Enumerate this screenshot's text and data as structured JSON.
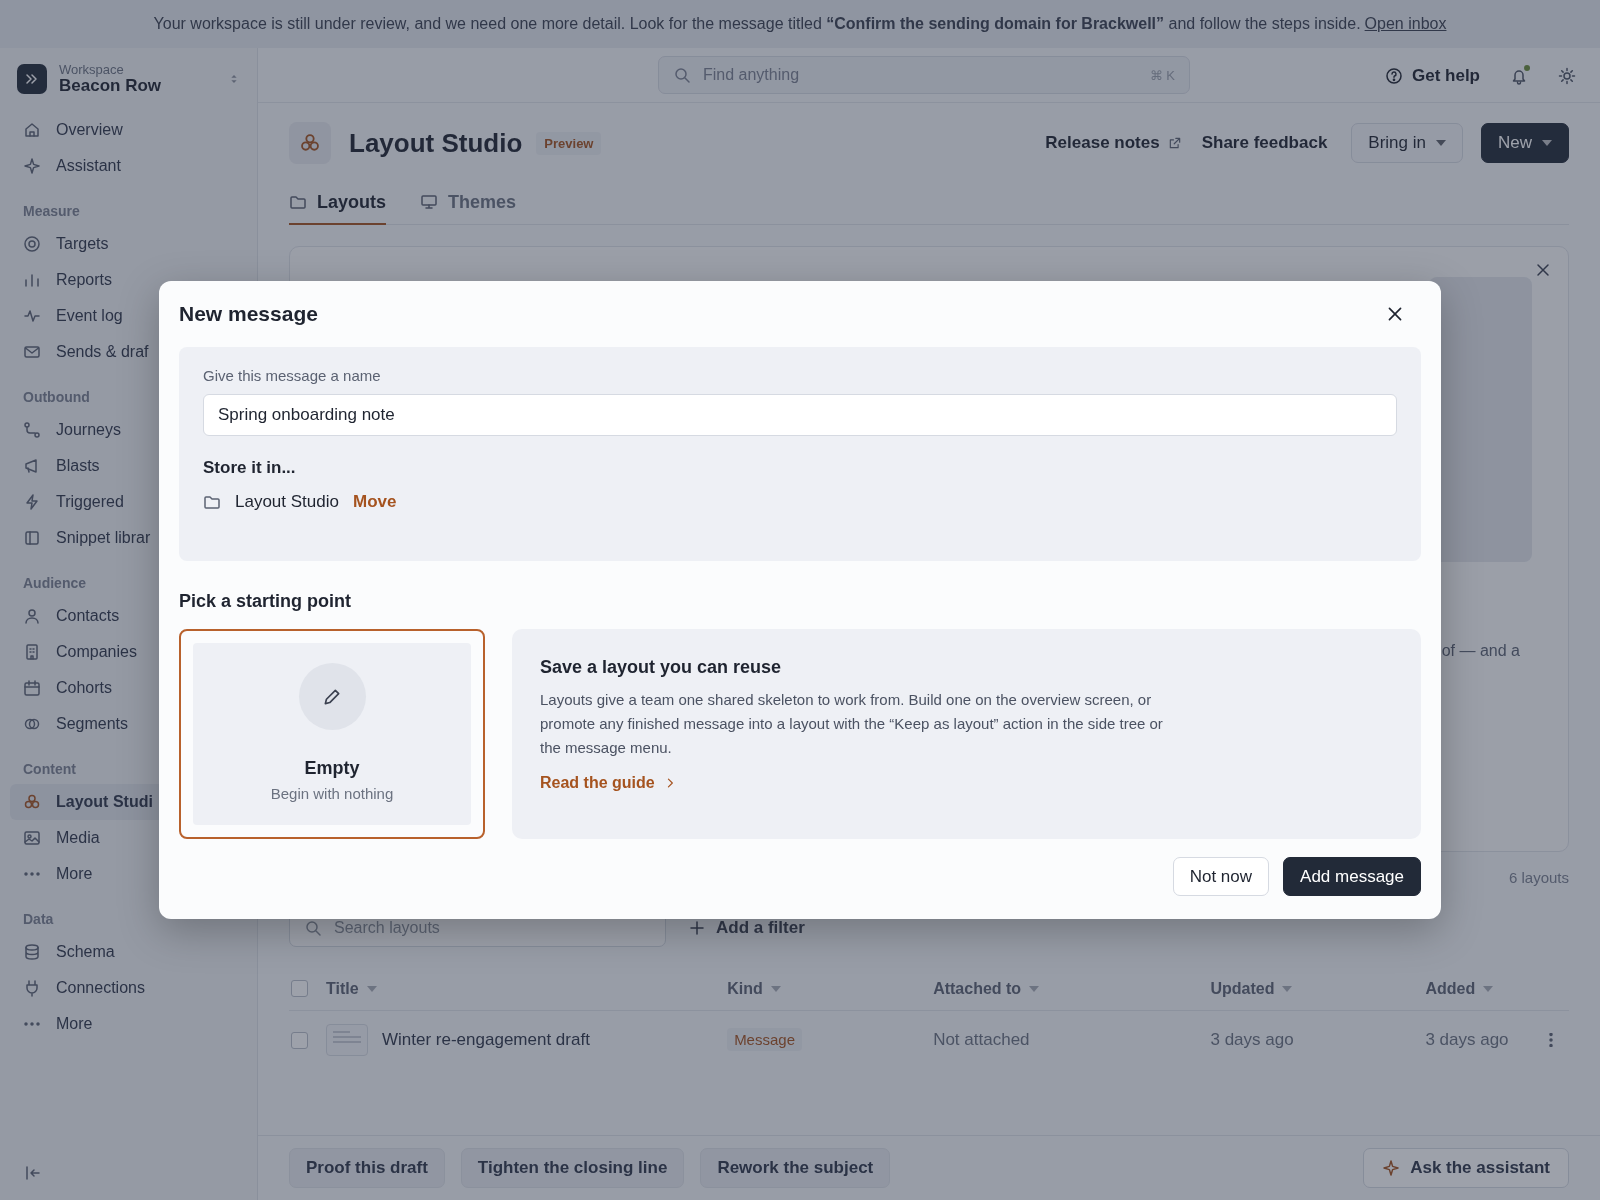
{
  "banner": {
    "text": "Your workspace is still under review, and we need one more detail. Look for the message titled **“Confirm the sending domain for Brackwell”** and follow the steps inside.",
    "link": "Open inbox"
  },
  "sidebar": {
    "workspace_label": "Workspace",
    "workspace_name": "Beacon Row",
    "top_items": [
      {
        "label": "Overview",
        "selected": false
      },
      {
        "label": "Assistant",
        "selected": false
      }
    ],
    "groups": [
      {
        "heading": "Measure",
        "items": [
          {
            "label": "Targets",
            "selected": false
          },
          {
            "label": "Reports",
            "selected": false
          },
          {
            "label": "Event log",
            "selected": false
          },
          {
            "label": "Sends & draf",
            "selected": false
          }
        ]
      },
      {
        "heading": "Outbound",
        "items": [
          {
            "label": "Journeys",
            "selected": false
          },
          {
            "label": "Blasts",
            "selected": false
          },
          {
            "label": "Triggered",
            "selected": false
          },
          {
            "label": "Snippet librar",
            "selected": false
          }
        ]
      },
      {
        "heading": "Audience",
        "items": [
          {
            "label": "Contacts",
            "selected": false
          },
          {
            "label": "Companies",
            "selected": false
          },
          {
            "label": "Cohorts",
            "selected": false
          },
          {
            "label": "Segments",
            "selected": false
          }
        ]
      },
      {
        "heading": "Content",
        "items": [
          {
            "label": "Layout Studi",
            "selected": true
          },
          {
            "label": "Media",
            "selected": false
          },
          {
            "label": "More",
            "selected": false
          }
        ]
      },
      {
        "heading": "Data",
        "items": [
          {
            "label": "Schema",
            "selected": false
          },
          {
            "label": "Connections",
            "selected": false
          },
          {
            "label": "More",
            "selected": false
          }
        ]
      }
    ]
  },
  "topbar": {
    "search_placeholder": "Find anything",
    "shortcut": "⌘ K",
    "help": "Get help",
    "notifications_unread": true
  },
  "page": {
    "title": "Layout Studio",
    "badge": "Preview",
    "release_notes": "Release notes",
    "share_feedback": "Share feedback",
    "bring_in": "Bring in",
    "new": "New",
    "tabs": [
      {
        "label": "Layouts",
        "selected": true
      },
      {
        "label": "Themes",
        "selected": false
      }
    ],
    "intro_card": {
      "text_fragment": "of — and a"
    },
    "count": "6 layouts",
    "search_placeholder": "Search layouts",
    "add_filter": "Add a filter",
    "table": {
      "all_checked": false,
      "columns": [
        "Title",
        "Kind",
        "Attached to",
        "Updated",
        "Added"
      ],
      "rows": [
        {
          "checked": false,
          "title": "Winter re-engagement draft",
          "kind": "Message",
          "attached": "Not attached",
          "updated": "3 days ago",
          "added": "3 days ago"
        }
      ]
    }
  },
  "suggestions": [
    "Proof this draft",
    "Tighten the closing line",
    "Rework the subject"
  ],
  "assistant_button": "Ask the assistant",
  "modal": {
    "title": "New message",
    "name_label": "Give this message a name",
    "name_value": "Spring onboarding note",
    "store_label": "Store it in...",
    "folder": "Layout Studio",
    "move": "Move",
    "pick_label": "Pick a starting point",
    "options": [
      {
        "title": "Empty",
        "subtitle": "Begin with nothing",
        "selected": true
      }
    ],
    "info": {
      "title": "Save a layout you can reuse",
      "text": "Layouts give a team one shared skeleton to work from. Build one on the overview screen, or promote any finished message into a layout with the “Keep as layout” action in the side tree or the message menu.",
      "link": "Read the guide"
    },
    "cancel": "Not now",
    "confirm": "Add message"
  }
}
